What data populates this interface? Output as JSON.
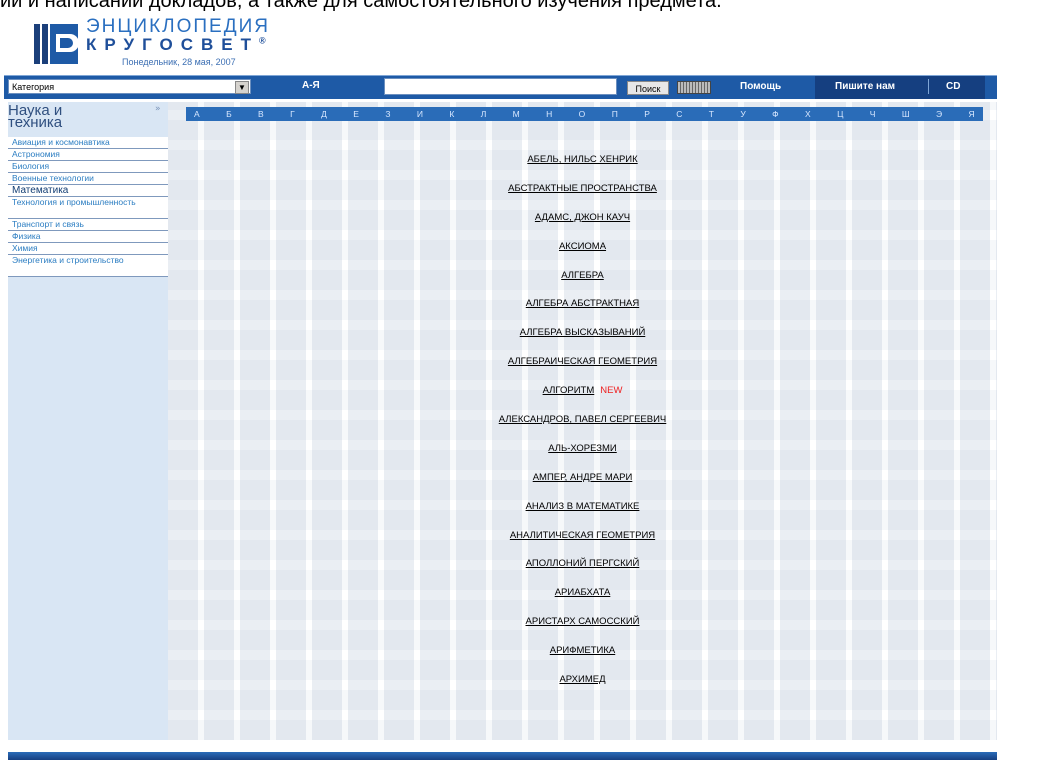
{
  "top_caption": "ии и написании докладов, а также для самостоятельного изучения предмета.",
  "logo": {
    "title": "ЭНЦИКЛОПЕДИЯ",
    "subtitle": "КРУГОСВЕТ",
    "date": "Понедельник, 28 мая, 2007"
  },
  "toolbar": {
    "category": "Категория",
    "az": "А-Я",
    "search_value": "",
    "search_button": "Поиск",
    "help": "Помощь",
    "write": "Пишите нам",
    "cd": "CD"
  },
  "sidebar": {
    "title_line1": "Наука и",
    "title_line2": "техника",
    "items": [
      {
        "label": "Авиация и космонавтика",
        "active": false
      },
      {
        "label": "Астрономия",
        "active": false
      },
      {
        "label": "Биология",
        "active": false
      },
      {
        "label": "Военные технологии",
        "active": false
      },
      {
        "label": "Математика",
        "active": true
      },
      {
        "label": "Технология и промышленность",
        "active": false
      },
      {
        "label": "Транспорт и связь",
        "active": false
      },
      {
        "label": "Физика",
        "active": false
      },
      {
        "label": "Химия",
        "active": false
      },
      {
        "label": "Энергетика и строительство",
        "active": false
      }
    ]
  },
  "alphabet": [
    "А",
    "Б",
    "В",
    "Г",
    "Д",
    "Е",
    "З",
    "И",
    "К",
    "Л",
    "М",
    "Н",
    "О",
    "П",
    "Р",
    "С",
    "Т",
    "У",
    "Ф",
    "Х",
    "Ц",
    "Ч",
    "Ш",
    "Э",
    "Я"
  ],
  "articles": [
    {
      "title": "АБЕЛЬ, НИЛЬС ХЕНРИК",
      "new": ""
    },
    {
      "title": "АБСТРАКТНЫЕ ПРОСТРАНСТВА",
      "new": ""
    },
    {
      "title": "АДАМС, ДЖОН КАУЧ",
      "new": ""
    },
    {
      "title": "АКСИОМА",
      "new": ""
    },
    {
      "title": "АЛГЕБРА",
      "new": ""
    },
    {
      "title": "АЛГЕБРА АБСТРАКТНАЯ",
      "new": ""
    },
    {
      "title": "АЛГЕБРА ВЫСКАЗЫВАНИЙ",
      "new": ""
    },
    {
      "title": "АЛГЕБРАИЧЕСКАЯ ГЕОМЕТРИЯ",
      "new": ""
    },
    {
      "title": "АЛГОРИТМ",
      "new": "NEW"
    },
    {
      "title": "АЛЕКСАНДРОВ, ПАВЕЛ СЕРГЕЕВИЧ",
      "new": ""
    },
    {
      "title": "АЛЬ-ХОРЕЗМИ",
      "new": ""
    },
    {
      "title": "АМПЕР, АНДРЕ МАРИ",
      "new": ""
    },
    {
      "title": "АНАЛИЗ В МАТЕМАТИКЕ",
      "new": ""
    },
    {
      "title": "АНАЛИТИЧЕСКАЯ ГЕОМЕТРИЯ",
      "new": ""
    },
    {
      "title": "АПОЛЛОНИЙ ПЕРГСКИЙ",
      "new": ""
    },
    {
      "title": "АРИАБХАТА",
      "new": ""
    },
    {
      "title": "АРИСТАРХ САМОССКИЙ",
      "new": ""
    },
    {
      "title": "АРИФМЕТИКА",
      "new": ""
    },
    {
      "title": "АРХИМЕД",
      "new": ""
    }
  ],
  "colors": {
    "toolbar": "#1e5aa6",
    "sidebar": "#d9e6f4",
    "alphabet_bar": "#2a6cb8",
    "new": "#e22222"
  }
}
